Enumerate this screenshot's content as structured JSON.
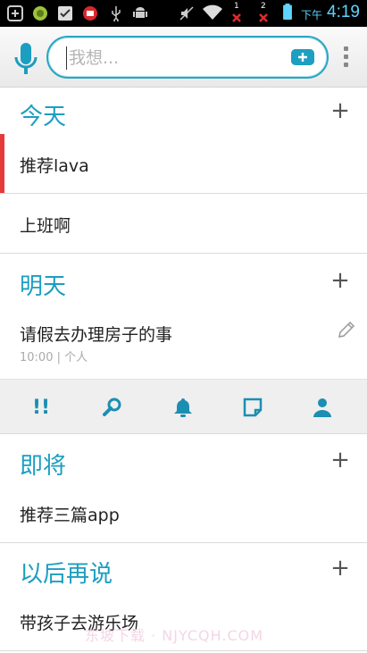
{
  "status_bar": {
    "ampm": "下午",
    "time": "4:19",
    "sim1_label": "1",
    "sim2_label": "2"
  },
  "search": {
    "placeholder": "我想..."
  },
  "sections": [
    {
      "title": "今天",
      "tasks": [
        {
          "label": "推荐lava",
          "highlighted": true
        },
        {
          "label": "上班啊"
        }
      ]
    },
    {
      "title": "明天",
      "tasks": [
        {
          "label": "请假去办理房子的事",
          "meta": "10:00 | 个人"
        }
      ]
    },
    {
      "title": "即将",
      "tasks": [
        {
          "label": "推荐三篇app"
        }
      ]
    },
    {
      "title": "以后再说",
      "tasks": [
        {
          "label": "带孩子去游乐场"
        }
      ]
    }
  ],
  "toolbar": {
    "priority_label": "!!",
    "items": [
      "priority-icon",
      "search-icon",
      "bell-icon",
      "note-icon",
      "contact-icon"
    ]
  },
  "plus_label": "+",
  "watermark": "东坡下载 · NJYCQH.COM",
  "colors": {
    "accent": "#1b9ec1",
    "highlight": "#e63a3a",
    "status_bar": "#000000"
  }
}
